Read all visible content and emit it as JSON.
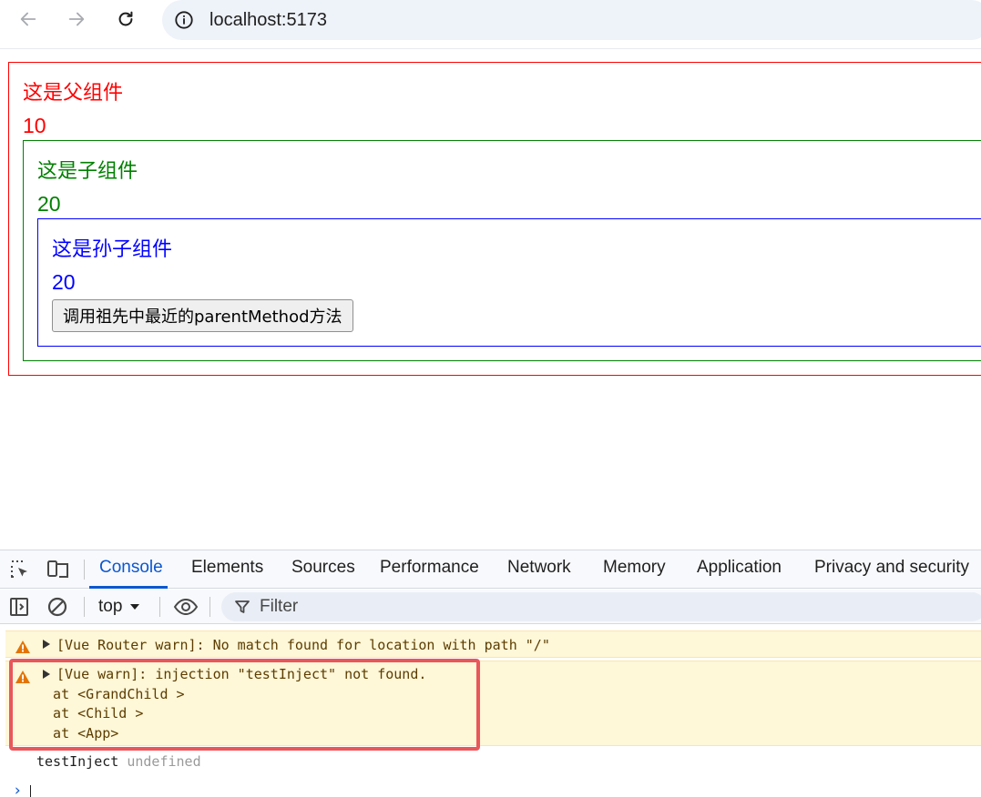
{
  "browser": {
    "url": "localhost:5173",
    "icons": [
      "back-arrow-icon",
      "forward-arrow-icon",
      "reload-icon",
      "info-icon"
    ]
  },
  "page": {
    "parent": {
      "title": "这是父组件",
      "count": "10",
      "color": "#ff0000"
    },
    "child": {
      "title": "这是子组件",
      "count": "20",
      "color": "#008000"
    },
    "grandchild": {
      "title": "这是孙子组件",
      "count": "20",
      "color": "#0000ff",
      "button_label": "调用祖先中最近的parentMethod方法"
    }
  },
  "devtools": {
    "tabs": [
      "Console",
      "Elements",
      "Sources",
      "Performance",
      "Network",
      "Memory",
      "Application",
      "Privacy and security"
    ],
    "active_tab": "Console",
    "toolbar": {
      "context": "top",
      "filter_placeholder": "Filter"
    },
    "messages": [
      {
        "level": "warning",
        "lines": [
          "[Vue Router warn]: No match found for location with path \"/\""
        ]
      },
      {
        "level": "warning",
        "highlighted": true,
        "lines": [
          "[Vue warn]: injection \"testInject\" not found.",
          "  at <GrandChild >",
          "  at <Child >",
          "  at <App>"
        ]
      }
    ],
    "log": {
      "label": "testInject",
      "value": "undefined"
    },
    "colors": {
      "accent": "#0b57d0",
      "warning_bg": "#fef7d8",
      "highlight": "#e9575b"
    }
  }
}
